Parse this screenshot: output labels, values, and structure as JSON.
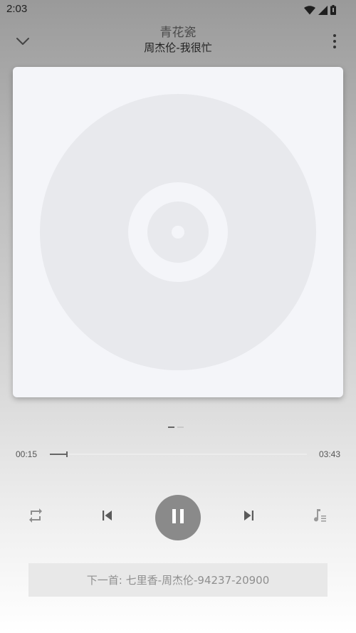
{
  "status_bar": {
    "time": "2:03",
    "icons": [
      "wifi-icon",
      "signal-icon",
      "battery-icon"
    ]
  },
  "header": {
    "title": "青花瓷",
    "subtitle": "周杰伦-我很忙",
    "back_icon": "chevron-down-icon",
    "more_icon": "more-vert-icon"
  },
  "album": {
    "placeholder_icon": "vinyl-disc-icon"
  },
  "player": {
    "current_time": "00:15",
    "total_time": "03:43",
    "progress": 0.067,
    "is_playing": true
  },
  "controls": {
    "repeat_icon": "repeat-icon",
    "prev_icon": "skip-previous-icon",
    "play_pause_icon": "pause-icon",
    "next_icon": "skip-next-icon",
    "playlist_icon": "playlist-icon"
  },
  "next_up": {
    "text": "下一首: 七里香-周杰伦-94237-20900"
  },
  "colors": {
    "play_button": "#8a8a8a",
    "album_bg": "#f4f5f9",
    "disc": "#e8e9ed"
  }
}
